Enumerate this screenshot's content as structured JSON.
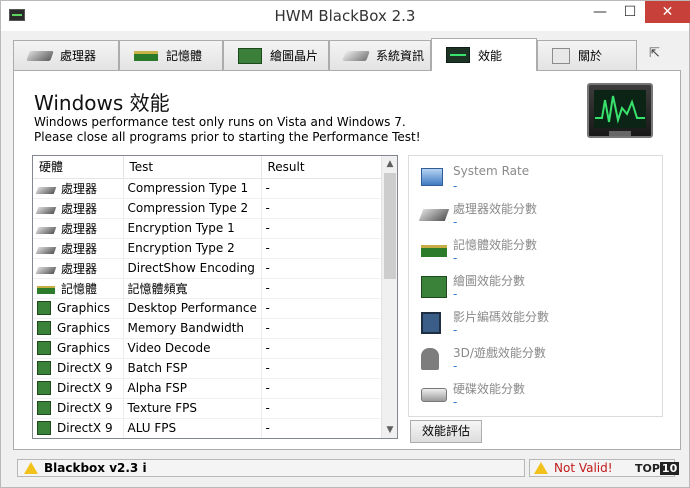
{
  "window": {
    "title": "HWM BlackBox 2.3",
    "controls": {
      "minimize": "—",
      "maximize": "☐",
      "close": "✕"
    }
  },
  "tabs": [
    {
      "label": "處理器",
      "icon": "cpu-icon"
    },
    {
      "label": "記憶體",
      "icon": "memory-icon"
    },
    {
      "label": "繪圖晶片",
      "icon": "graphics-card-icon"
    },
    {
      "label": "系統資訊",
      "icon": "system-info-icon"
    },
    {
      "label": "效能",
      "icon": "performance-monitor-icon"
    },
    {
      "label": "關於",
      "icon": "about-icon"
    }
  ],
  "tab_extra_icon": "export-icon",
  "panel": {
    "title": "Windows 效能",
    "desc1": "Windows performance test only runs on Vista and Windows 7.",
    "desc2": "Please close all programs prior to starting the Performance Test!"
  },
  "table": {
    "headers": [
      "硬體",
      "Test",
      "Result"
    ],
    "rows": [
      {
        "hw": "處理器",
        "icon": "cpu",
        "test": "Compression Type 1",
        "result": "-"
      },
      {
        "hw": "處理器",
        "icon": "cpu",
        "test": "Compression Type 2",
        "result": "-"
      },
      {
        "hw": "處理器",
        "icon": "cpu",
        "test": "Encryption Type 1",
        "result": "-"
      },
      {
        "hw": "處理器",
        "icon": "cpu",
        "test": "Encryption Type 2",
        "result": "-"
      },
      {
        "hw": "處理器",
        "icon": "cpu",
        "test": "DirectShow Encoding",
        "result": "-"
      },
      {
        "hw": "記憶體",
        "icon": "ram",
        "test": "記憶體頻寬",
        "result": "-"
      },
      {
        "hw": "Graphics",
        "icon": "gfx",
        "test": "Desktop Performance",
        "result": "-"
      },
      {
        "hw": "Graphics",
        "icon": "gfx",
        "test": "Memory Bandwidth",
        "result": "-"
      },
      {
        "hw": "Graphics",
        "icon": "gfx",
        "test": "Video Decode",
        "result": "-"
      },
      {
        "hw": "DirectX 9",
        "icon": "gfx",
        "test": "Batch FSP",
        "result": "-"
      },
      {
        "hw": "DirectX 9",
        "icon": "gfx",
        "test": "Alpha FSP",
        "result": "-"
      },
      {
        "hw": "DirectX 9",
        "icon": "gfx",
        "test": "Texture FPS",
        "result": "-"
      },
      {
        "hw": "DirectX 9",
        "icon": "gfx",
        "test": "ALU FPS",
        "result": "-"
      }
    ],
    "scroll_up": "▲",
    "scroll_down": "▼"
  },
  "rates": [
    {
      "label": "System Rate",
      "value": "-",
      "icon": "system-icon"
    },
    {
      "label": "處理器效能分數",
      "value": "-",
      "icon": "cpu-icon"
    },
    {
      "label": "記憶體效能分數",
      "value": "-",
      "icon": "memory-icon"
    },
    {
      "label": "繪圖效能分數",
      "value": "-",
      "icon": "graphics-card-icon"
    },
    {
      "label": "影片編碼效能分數",
      "value": "-",
      "icon": "video-icon"
    },
    {
      "label": "3D/遊戲效能分數",
      "value": "-",
      "icon": "game-icon"
    },
    {
      "label": "硬碟效能分數",
      "value": "-",
      "icon": "disk-icon"
    }
  ],
  "score_button": "效能評估",
  "status": {
    "left": "Blackbox v2.3 i",
    "right": "Not Valid!",
    "logo_a": "TOP",
    "logo_b": "10"
  },
  "colors": {
    "close": "#c7413a",
    "value_link": "#2f7fd6",
    "warning_text": "#c21a1a"
  }
}
